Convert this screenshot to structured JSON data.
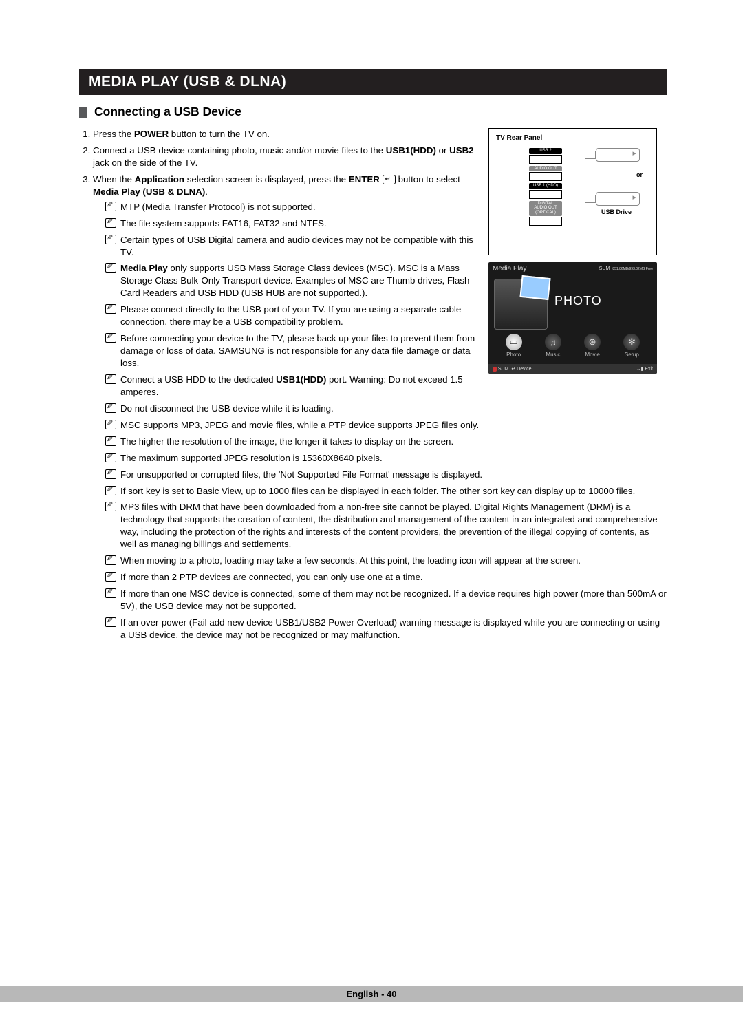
{
  "chapter_title": "MEDIA PLAY (USB & DLNA)",
  "section_title": "Connecting a USB Device",
  "steps": {
    "s1_pre": "Press the ",
    "s1_b": "POWER",
    "s1_post": " button to turn the TV on.",
    "s2_pre": "Connect a USB device containing photo, music and/or movie files to the ",
    "s2_b1": "USB1(HDD)",
    "s2_mid": " or ",
    "s2_b2": "USB2",
    "s2_post": " jack on the side of the TV.",
    "s3_pre": "When the ",
    "s3_b1": "Application",
    "s3_mid": " selection screen is displayed, press the ",
    "s3_b2": "ENTER",
    "s3_post1": " button to select ",
    "s3_b3": "Media Play (USB & DLNA)",
    "s3_post2": "."
  },
  "notes_left": [
    "MTP (Media Transfer Protocol) is not supported.",
    "The file system supports FAT16, FAT32 and NTFS.",
    "Certain types of USB Digital camera and audio devices may not be compatible with this TV."
  ],
  "note_mediaplay_b": "Media Play",
  "note_mediaplay_rest": " only supports USB Mass Storage Class devices (MSC). MSC is a Mass Storage Class Bulk-Only Transport device. Examples of MSC are Thumb drives, Flash Card Readers and USB HDD (USB HUB are not supported.).",
  "notes_left2": [
    "Please connect directly to the USB port of your TV. If you are using a separate cable connection, there may be a USB compatibility problem.",
    "Before connecting your device to the TV, please back up your files to prevent them from damage or loss of data. SAMSUNG is not responsible for any data file damage or data loss."
  ],
  "note_hdd_pre": "Connect a USB HDD to the dedicated ",
  "note_hdd_b": "USB1(HDD)",
  "note_hdd_post": " port. Warning: Do not exceed 1.5 amperes.",
  "notes_full": [
    "Do not disconnect the USB device while it is loading.",
    "MSC supports MP3, JPEG and movie files, while a PTP device supports JPEG files only.",
    "The higher the resolution of the image, the longer it takes to display on the screen.",
    "The maximum supported JPEG resolution is 15360X8640 pixels.",
    "For unsupported or corrupted files, the 'Not Supported File Format' message is displayed.",
    "If sort key is set to Basic View, up to 1000 files can be displayed in each folder. The other sort key can display up to 10000 files.",
    "MP3 files with DRM that have been downloaded from a non-free site cannot be played. Digital Rights Management (DRM) is a technology that supports the creation of content, the distribution and management of the content in an integrated and comprehensive way, including the protection of the rights and interests of the content providers, the prevention of the illegal copying of contents, as well as managing billings and settlements.",
    "When moving to a photo, loading may take a few seconds. At this point, the loading icon will appear at the screen.",
    "If more than 2 PTP devices are connected, you can only use one at a time.",
    "If more than one MSC device is connected, some of them may not be recognized. If a device requires high power (more than 500mA or 5V), the USB device may not be supported.",
    "If an over-power (Fail add new device USB1/USB2 Power Overload) warning message is displayed while you are connecting or using a USB device, the device may not be recognized or may malfunction."
  ],
  "diagram1": {
    "title": "TV Rear Panel",
    "usb2": "USB 2",
    "audio_out": "AUDIO OUT",
    "usb1": "USB 1 (HDD)",
    "digital": "DIGITAL\nAUDIO OUT\n(OPTICAL)",
    "or": "or",
    "usbdrive": "USB Drive"
  },
  "diagram2": {
    "header": "Media Play",
    "sum": "SUM",
    "free": "851.86MB/993.02MB Free",
    "photo_title": "PHOTO",
    "icons": [
      "Photo",
      "Music",
      "Movie",
      "Setup"
    ],
    "foot_left": "SUM",
    "foot_device": "Device",
    "foot_exit": "Exit"
  },
  "footer": "English - 40"
}
